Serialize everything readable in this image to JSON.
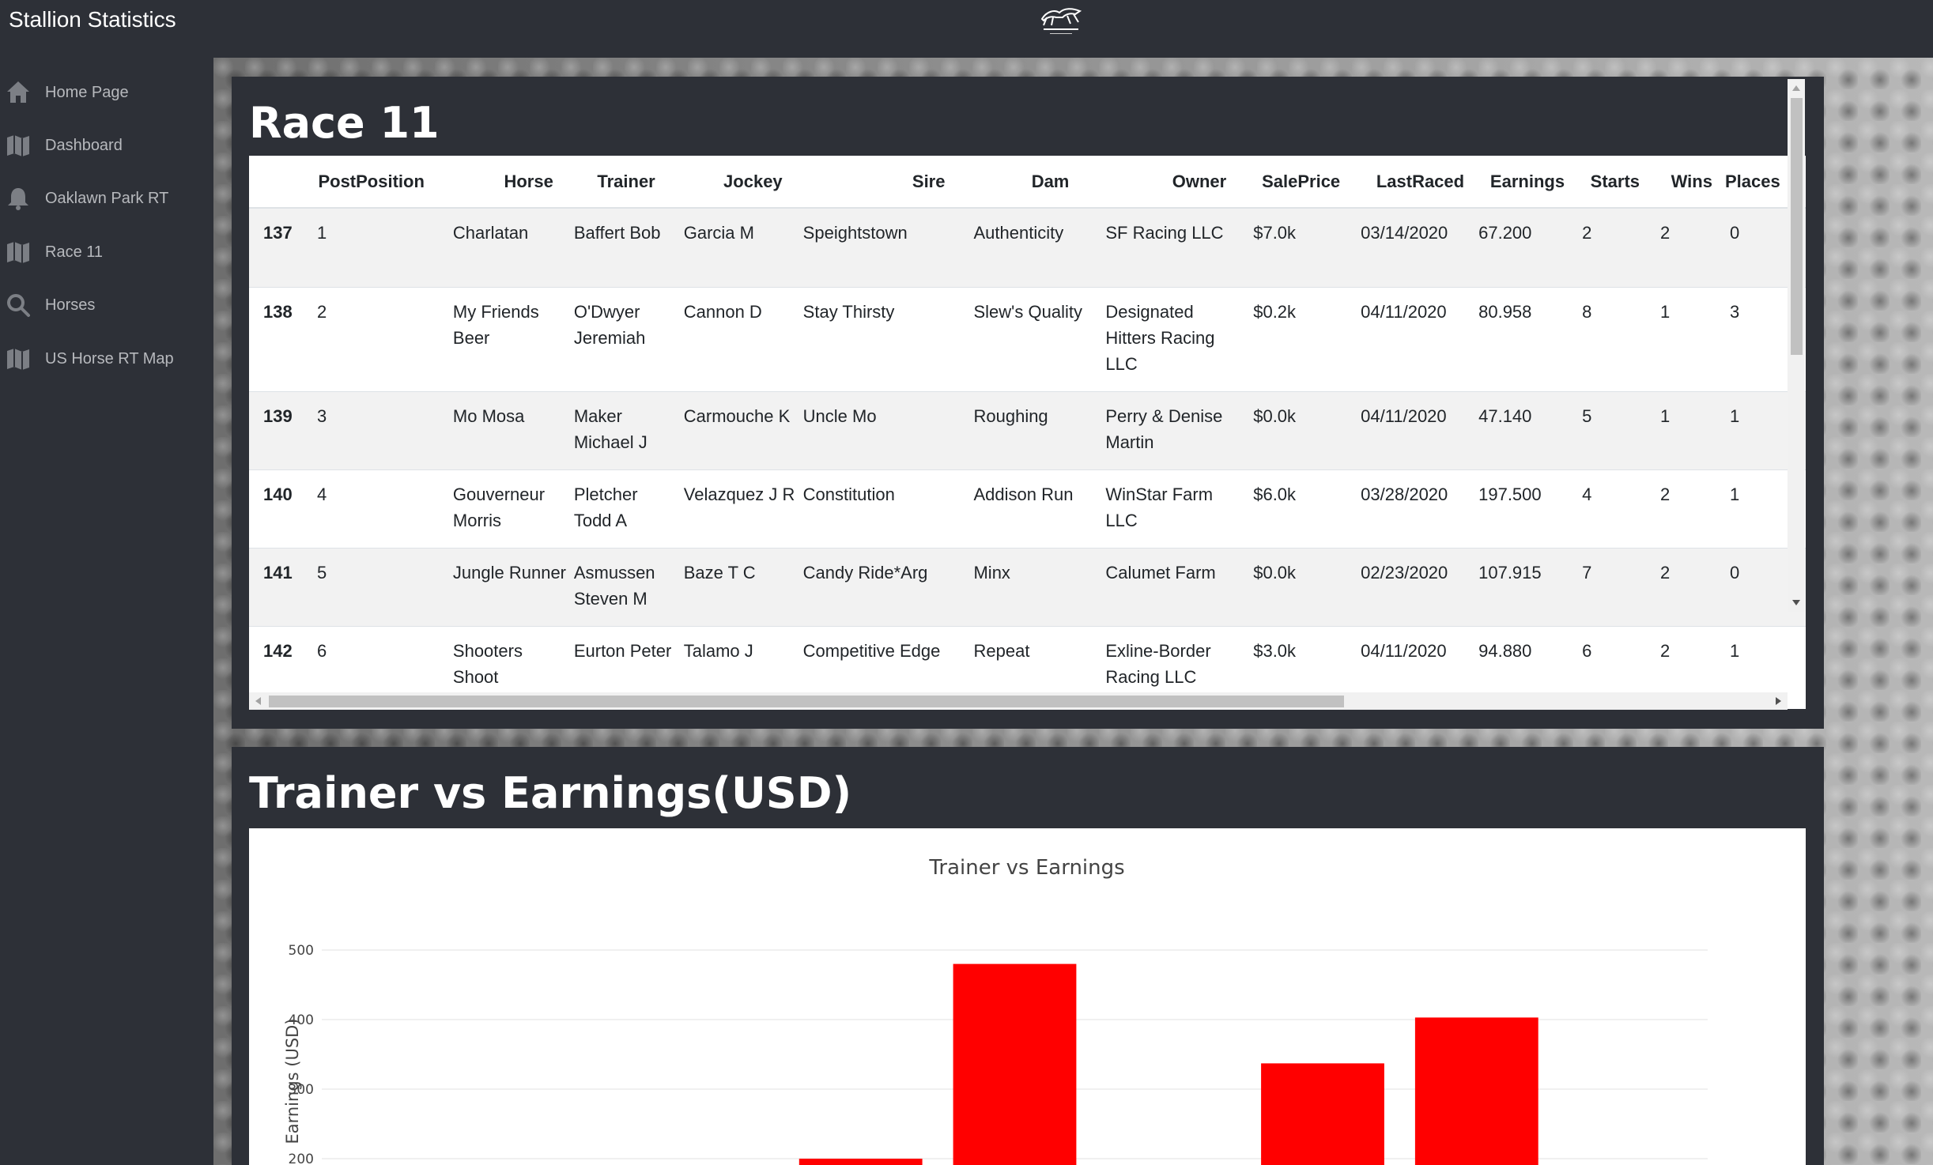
{
  "app": {
    "title": "Stallion Statistics",
    "logo_icon": "stallion-logo-icon"
  },
  "sidebar": {
    "items": [
      {
        "label": "Home Page",
        "icon": "home-icon"
      },
      {
        "label": "Dashboard",
        "icon": "map-icon"
      },
      {
        "label": "Oaklawn Park RT",
        "icon": "bell-icon"
      },
      {
        "label": "Race 11",
        "icon": "map-icon"
      },
      {
        "label": "Horses",
        "icon": "search-icon"
      },
      {
        "label": "US Horse RT Map",
        "icon": "map-icon"
      }
    ]
  },
  "race_panel": {
    "title": "Race 11",
    "columns": [
      "",
      "PostPosition",
      "Horse",
      "Trainer",
      "Jockey",
      "Sire",
      "Dam",
      "Owner",
      "SalePrice",
      "LastRaced",
      "Earnings",
      "Starts",
      "Wins",
      "Places"
    ],
    "rows": [
      {
        "idx": "137",
        "post": "1",
        "horse": "Charlatan",
        "trainer": "Baffert Bob",
        "jockey": "Garcia M",
        "sire": "Speightstown",
        "dam": "Authenticity",
        "owner": "SF Racing LLC",
        "sale": "$7.0k",
        "last": "03/14/2020",
        "earn": "67.200",
        "starts": "2",
        "wins": "2",
        "places": "0"
      },
      {
        "idx": "138",
        "post": "2",
        "horse": "My Friends Beer",
        "trainer": "O'Dwyer Jeremiah",
        "jockey": "Cannon D",
        "sire": "Stay Thirsty",
        "dam": "Slew's Quality",
        "owner": "Designated Hitters Racing LLC",
        "sale": "$0.2k",
        "last": "04/11/2020",
        "earn": "80.958",
        "starts": "8",
        "wins": "1",
        "places": "3"
      },
      {
        "idx": "139",
        "post": "3",
        "horse": "Mo Mosa",
        "trainer": "Maker Michael J",
        "jockey": "Carmouche K",
        "sire": "Uncle Mo",
        "dam": "Roughing",
        "owner": "Perry & Denise Martin",
        "sale": "$0.0k",
        "last": "04/11/2020",
        "earn": "47.140",
        "starts": "5",
        "wins": "1",
        "places": "1"
      },
      {
        "idx": "140",
        "post": "4",
        "horse": "Gouverneur Morris",
        "trainer": "Pletcher Todd A",
        "jockey": "Velazquez J R",
        "sire": "Constitution",
        "dam": "Addison Run",
        "owner": "WinStar Farm LLC",
        "sale": "$6.0k",
        "last": "03/28/2020",
        "earn": "197.500",
        "starts": "4",
        "wins": "2",
        "places": "1"
      },
      {
        "idx": "141",
        "post": "5",
        "horse": "Jungle Runner",
        "trainer": "Asmussen Steven M",
        "jockey": "Baze T C",
        "sire": "Candy Ride*Arg",
        "dam": "Minx",
        "owner": "Calumet Farm",
        "sale": "$0.0k",
        "last": "02/23/2020",
        "earn": "107.915",
        "starts": "7",
        "wins": "2",
        "places": "0"
      },
      {
        "idx": "142",
        "post": "6",
        "horse": "Shooters Shoot",
        "trainer": "Eurton Peter",
        "jockey": "Talamo J",
        "sire": "Competitive Edge",
        "dam": "Repeat",
        "owner": "Exline-Border Racing LLC",
        "sale": "$3.0k",
        "last": "04/11/2020",
        "earn": "94.880",
        "starts": "6",
        "wins": "2",
        "places": "1"
      }
    ]
  },
  "chart_panel": {
    "title": "Trainer vs Earnings(USD)"
  },
  "chart_data": {
    "type": "bar",
    "title": "Trainer vs Earnings",
    "ylabel": "Earnings (USD)",
    "xlabel": "",
    "yticks": [
      200,
      300,
      400,
      500
    ],
    "visible_range": [
      190,
      530
    ],
    "grid": true,
    "bar_color": "#ff0000",
    "categories": [
      "",
      "",
      "",
      "",
      "",
      "",
      "",
      "",
      ""
    ],
    "values": [
      0,
      0,
      0,
      200,
      480,
      0,
      337,
      403,
      0
    ]
  }
}
